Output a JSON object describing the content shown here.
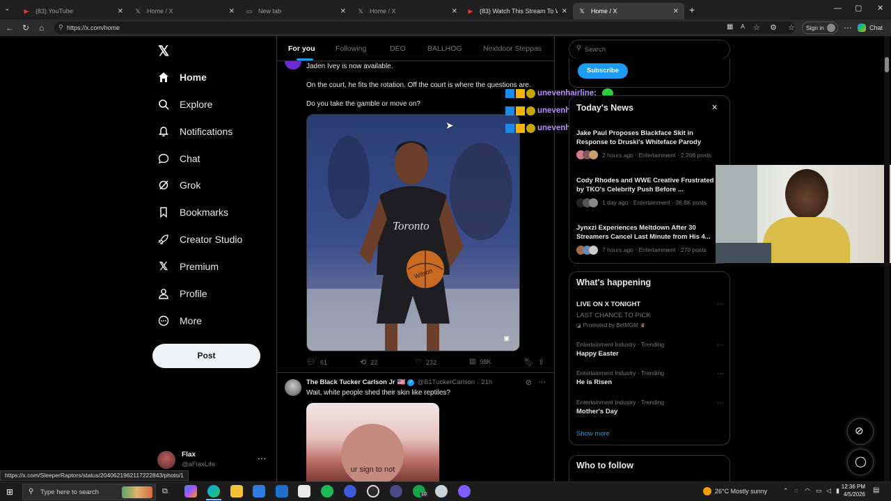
{
  "browser": {
    "tabs": [
      {
        "title": "(83) YouTube",
        "icon": "youtube-icon"
      },
      {
        "title": "Home / X",
        "icon": "x-logo-icon"
      },
      {
        "title": "New tab",
        "icon": "newtab-icon"
      },
      {
        "title": "Home / X",
        "icon": "x-logo-icon"
      },
      {
        "title": "(83) Watch This Stream To Win $1,",
        "icon": "youtube-icon"
      },
      {
        "title": "Home / X",
        "icon": "x-logo-icon"
      }
    ],
    "url": "https://x.com/home",
    "sign_in": "Sign in",
    "chat": "Chat",
    "status_url": "https://x.com/SleeperRaptors/status/2040621962117222843/photo/1"
  },
  "nav": {
    "items": [
      {
        "label": "Home",
        "icon": "home-icon"
      },
      {
        "label": "Explore",
        "icon": "search-icon"
      },
      {
        "label": "Notifications",
        "icon": "bell-icon"
      },
      {
        "label": "Chat",
        "icon": "chat-icon"
      },
      {
        "label": "Grok",
        "icon": "grok-icon"
      },
      {
        "label": "Bookmarks",
        "icon": "bookmark-icon"
      },
      {
        "label": "Creator Studio",
        "icon": "rocket-icon"
      },
      {
        "label": "Premium",
        "icon": "x-logo-icon"
      },
      {
        "label": "Profile",
        "icon": "person-icon"
      },
      {
        "label": "More",
        "icon": "more-circle-icon"
      }
    ],
    "post": "Post",
    "account": {
      "name": "Flax",
      "handle": "@aFlaxLife"
    }
  },
  "feed": {
    "tabs": [
      "For you",
      "Following",
      "DEO",
      "BALLHOG",
      "Nextdoor Steppas"
    ],
    "post1": {
      "line1": "Jaden Ivey is now available.",
      "line2": "On the court, he fits the rotation. Off the court is where the questions are.",
      "line3": "Do you take the gamble or move on?",
      "jersey": "Toronto",
      "ball": "Wilson",
      "replies": "61",
      "reposts": "22",
      "likes": "232",
      "views": "98K"
    },
    "post2": {
      "author": "The Black Tucker Carlson Jr",
      "flag": "🇺🇸",
      "handle": "@B1TuckerCarlson",
      "time": "21h",
      "text": "Wait, white people shed their skin like reptiles?",
      "overlay": "ur sign to not"
    }
  },
  "chat_overlay": {
    "user": "unevenhairline:",
    "count": 3
  },
  "right": {
    "search_placeholder": "Search",
    "subscribe": "Subscribe",
    "news_title": "Today's News",
    "news": [
      {
        "title": "Jake Paul Proposes Blackface Skit in Response to Druski's Whiteface Parody",
        "meta": "2 hours ago · Entertainment · 2,266 posts"
      },
      {
        "title": "Cody Rhodes and WWE Creative Frustrated by TKO's Celebrity Push Before ...",
        "meta": "1 day ago · Entertainment · 36.8K posts"
      },
      {
        "title": "Jynxzi Experiences Meltdown After 30 Streamers Cancel Last Minute from His 4...",
        "meta": "7 hours ago · Entertainment · 270 posts"
      }
    ],
    "happening_title": "What's happening",
    "happening": [
      {
        "context": "",
        "title": "LIVE ON X TONIGHT",
        "sub": "LAST CHANCE TO PICK",
        "promo": "Promoted by BetMGM"
      },
      {
        "context": "Entertainment Industry · Trending",
        "title": "Happy Easter"
      },
      {
        "context": "Entertainment Industry · Trending",
        "title": "He is Risen"
      },
      {
        "context": "Entertainment Industry · Trending",
        "title": "Mother's Day"
      }
    ],
    "show_more": "Show more",
    "who_to_follow": "Who to follow"
  },
  "taskbar": {
    "search_placeholder": "Type here to search",
    "weather": "26°C  Mostly sunny",
    "time": "12:36 PM",
    "date": "4/5/2026",
    "badge": "10"
  },
  "colors": {
    "accent": "#1d9bf0",
    "background": "#000000",
    "chat_name": "#b68cff",
    "chat_emote": "#2ecc40"
  }
}
